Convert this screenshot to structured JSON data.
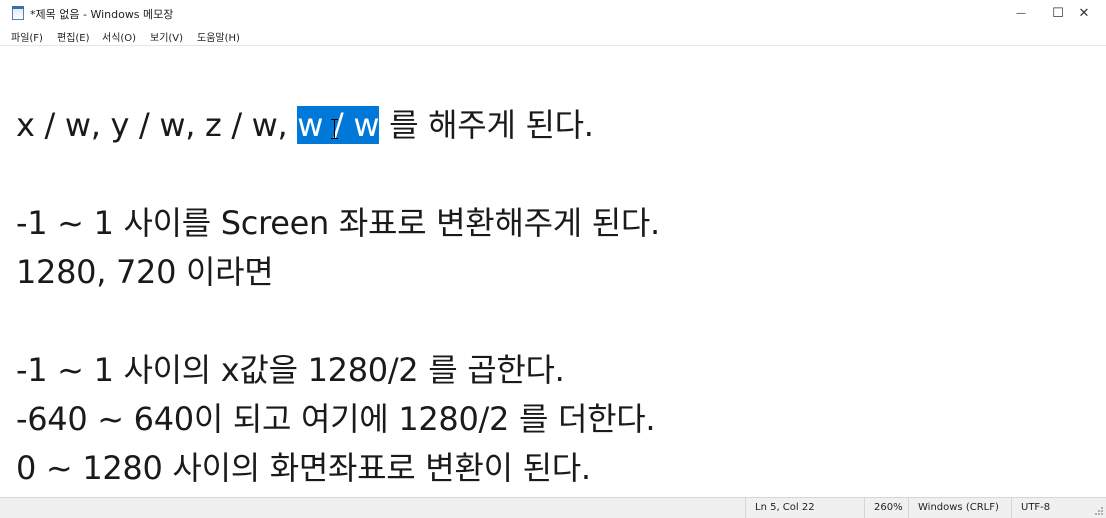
{
  "window": {
    "title": "*제목 없음 - Windows 메모장",
    "icon": "notepad-icon",
    "minimize_glyph": "—",
    "maximize_glyph": "☐",
    "close_glyph": "✕"
  },
  "menu": {
    "items": [
      {
        "label": "파일(F)"
      },
      {
        "label": "편집(E)"
      },
      {
        "label": "서식(O)"
      },
      {
        "label": "보기(V)"
      },
      {
        "label": "도움말(H)"
      }
    ]
  },
  "document": {
    "line1_before": "x / w, y / w, z / w, ",
    "line1_selected": "w / w",
    "line1_after": " 를 해주게 된다.",
    "line2": "-1 ~ 1 사이를 Screen 좌표로 변환해주게 된다.",
    "line3": "1280, 720 이라면",
    "line4": "-1 ~ 1 사이의 x값을 1280/2 를 곱한다.",
    "line5": "-640 ~ 640이 되고 여기에 1280/2 를 더한다.",
    "line6": "0 ~ 1280 사이의 화면좌표로 변환이 된다.",
    "selection_color": "#0078d7"
  },
  "status": {
    "position": "Ln 5, Col 22",
    "zoom": "260%",
    "line_ending": "Windows (CRLF)",
    "encoding": "UTF-8"
  }
}
